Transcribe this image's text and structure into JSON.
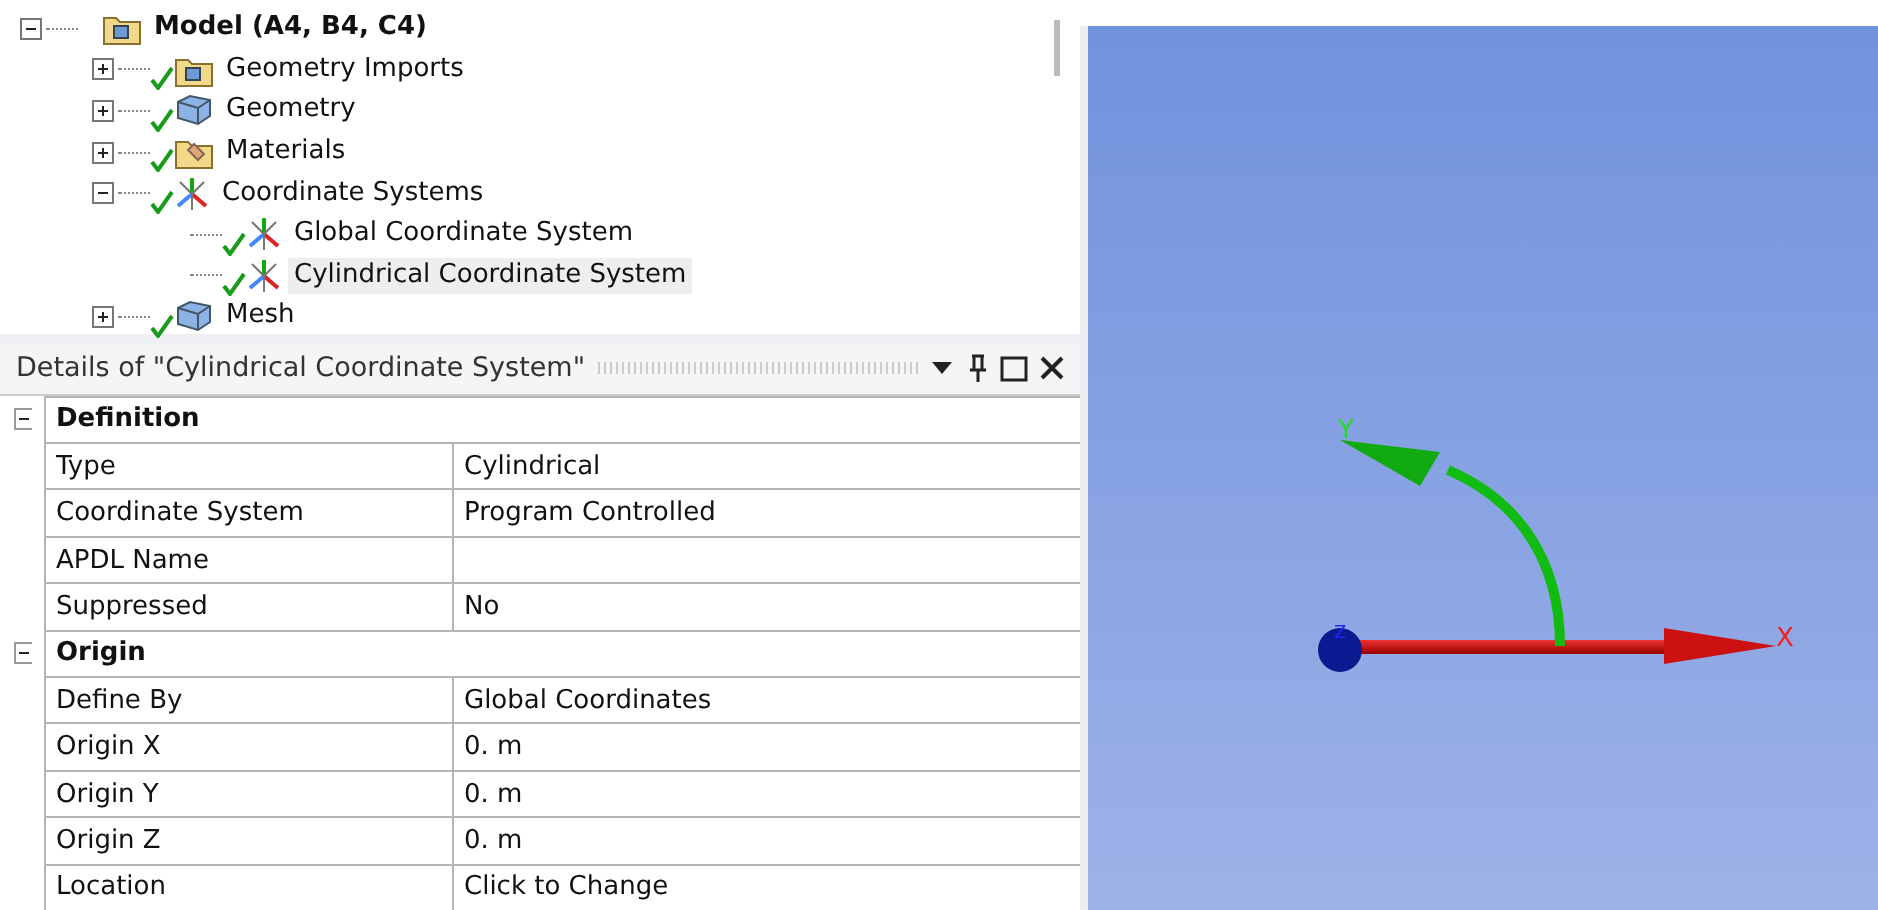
{
  "tree": {
    "label": "Model (A4, B4, C4)",
    "kind": "model",
    "expanded": true,
    "checked": false,
    "selected": false,
    "children": [
      {
        "label": "Geometry Imports",
        "kind": "folder",
        "expanded": false,
        "checked": true,
        "selected": false
      },
      {
        "label": "Geometry",
        "kind": "geometry",
        "expanded": false,
        "checked": true,
        "selected": false
      },
      {
        "label": "Materials",
        "kind": "materials",
        "expanded": false,
        "checked": true,
        "selected": false
      },
      {
        "label": "Coordinate Systems",
        "kind": "axes",
        "expanded": true,
        "checked": true,
        "selected": false,
        "children": [
          {
            "label": "Global Coordinate System",
            "kind": "axes",
            "checked": true,
            "selected": false
          },
          {
            "label": "Cylindrical Coordinate System",
            "kind": "axes",
            "checked": true,
            "selected": true
          }
        ]
      },
      {
        "label": "Mesh",
        "kind": "geometry",
        "expanded": false,
        "checked": true,
        "selected": false
      }
    ]
  },
  "details": {
    "title": "Details of \"Cylindrical Coordinate System\"",
    "sections": [
      {
        "title": "Definition",
        "expanded": true,
        "rows": [
          {
            "label": "Type",
            "value": "Cylindrical"
          },
          {
            "label": "Coordinate System",
            "value": "Program Controlled"
          },
          {
            "label": "APDL Name",
            "value": ""
          },
          {
            "label": "Suppressed",
            "value": "No"
          }
        ]
      },
      {
        "title": "Origin",
        "expanded": true,
        "rows": [
          {
            "label": "Define By",
            "value": "Global Coordinates"
          },
          {
            "label": "Origin X",
            "value": "0. m"
          },
          {
            "label": "Origin Y",
            "value": "0. m"
          },
          {
            "label": "Origin Z",
            "value": "0. m"
          },
          {
            "label": "Location",
            "value": "Click to Change"
          }
        ]
      }
    ]
  },
  "viewport": {
    "axes": {
      "x": "X",
      "y": "Y",
      "z": "Z"
    }
  }
}
